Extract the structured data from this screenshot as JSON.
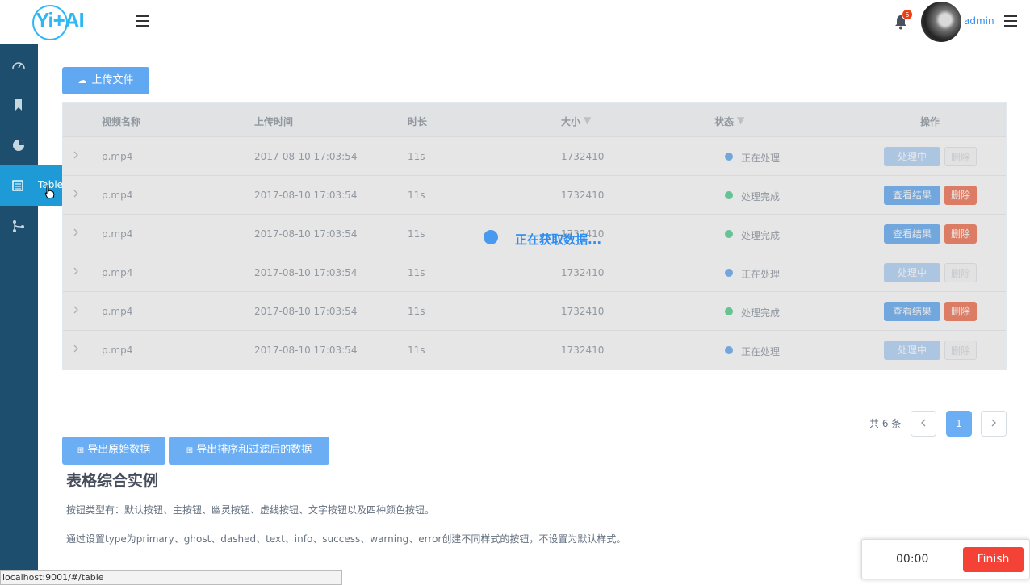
{
  "header": {
    "logo_text": "Yi+AI",
    "notification_count": "5",
    "username": "admin"
  },
  "sidebar": {
    "popup_label": "Table"
  },
  "content": {
    "upload_label": "上传文件",
    "table": {
      "columns": [
        "视频名称",
        "上传时间",
        "时长",
        "大小",
        "状态",
        "操作"
      ],
      "rows": [
        {
          "name": "p.mp4",
          "time": "2017-08-10 17:03:54",
          "duration": "11s",
          "size": "1732410",
          "status": "正在处理",
          "state": "processing",
          "action": "处理中",
          "delete": "删除"
        },
        {
          "name": "p.mp4",
          "time": "2017-08-10 17:03:54",
          "duration": "11s",
          "size": "1732410",
          "status": "处理完成",
          "state": "done",
          "action": "查看结果",
          "delete": "删除"
        },
        {
          "name": "p.mp4",
          "time": "2017-08-10 17:03:54",
          "duration": "11s",
          "size": "1732410",
          "status": "处理完成",
          "state": "done",
          "action": "查看结果",
          "delete": "删除"
        },
        {
          "name": "p.mp4",
          "time": "2017-08-10 17:03:54",
          "duration": "11s",
          "size": "1732410",
          "status": "正在处理",
          "state": "processing",
          "action": "处理中",
          "delete": "删除"
        },
        {
          "name": "p.mp4",
          "time": "2017-08-10 17:03:54",
          "duration": "11s",
          "size": "1732410",
          "status": "处理完成",
          "state": "done",
          "action": "查看结果",
          "delete": "删除"
        },
        {
          "name": "p.mp4",
          "time": "2017-08-10 17:03:54",
          "duration": "11s",
          "size": "1732410",
          "status": "正在处理",
          "state": "processing",
          "action": "处理中",
          "delete": "删除"
        }
      ],
      "loading_text": "正在获取数据..."
    },
    "pagination": {
      "total": "共 6 条",
      "current_page": "1"
    },
    "export_raw_label": "导出原始数据",
    "export_filtered_label": "导出排序和过滤后的数据",
    "section_title": "表格综合实例",
    "desc1": "按钮类型有：默认按钮、主按钮、幽灵按钮、虚线按钮、文字按钮以及四种颜色按钮。",
    "desc2": "通过设置type为primary、ghost、dashed、text、info、success、warning、error创建不同样式的按钮，不设置为默认样式。"
  },
  "browser": {
    "status_url": "localhost:9001/#/table"
  },
  "recorder": {
    "time": "00:00",
    "finish_label": "Finish"
  },
  "colors": {
    "primary": "#2d8cf0",
    "error": "#ed3f14",
    "success": "#19be6b",
    "sidebar": "#1d4e6e",
    "sidebar_active": "#1e9bd7"
  }
}
